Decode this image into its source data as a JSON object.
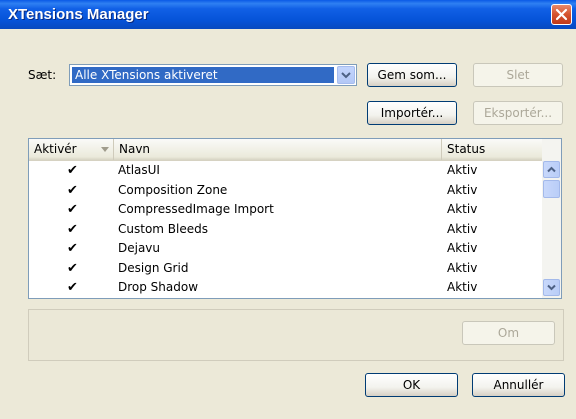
{
  "window": {
    "title": "XTensions Manager"
  },
  "set": {
    "label": "Sæt:",
    "selected": "Alle XTensions aktiveret"
  },
  "buttons": {
    "save_as": "Gem som...",
    "delete": "Slet",
    "import": "Importér...",
    "export": "Eksportér...",
    "about": "Om",
    "ok": "OK",
    "cancel": "Annullér"
  },
  "list": {
    "columns": [
      "Aktivér",
      "Navn",
      "Status"
    ],
    "rows": [
      {
        "enabled": "✔",
        "name": "AtlasUI",
        "status": "Aktiv"
      },
      {
        "enabled": "✔",
        "name": "Composition Zone",
        "status": "Aktiv"
      },
      {
        "enabled": "✔",
        "name": "CompressedImage Import",
        "status": "Aktiv"
      },
      {
        "enabled": "✔",
        "name": "Custom Bleeds",
        "status": "Aktiv"
      },
      {
        "enabled": "✔",
        "name": "Dejavu",
        "status": "Aktiv"
      },
      {
        "enabled": "✔",
        "name": "Design Grid",
        "status": "Aktiv"
      },
      {
        "enabled": "✔",
        "name": "Drop Shadow",
        "status": "Aktiv"
      }
    ]
  },
  "colors": {
    "titlebar": "#0553d8",
    "selection": "#316ac5",
    "dialog_bg": "#ece9d8",
    "close_button": "#d5532e"
  },
  "icons": {
    "close": "close-icon",
    "dropdown": "chevron-down-icon",
    "sort": "sort-down-icon",
    "scroll_up": "chevron-up-icon",
    "scroll_down": "chevron-down-icon"
  }
}
